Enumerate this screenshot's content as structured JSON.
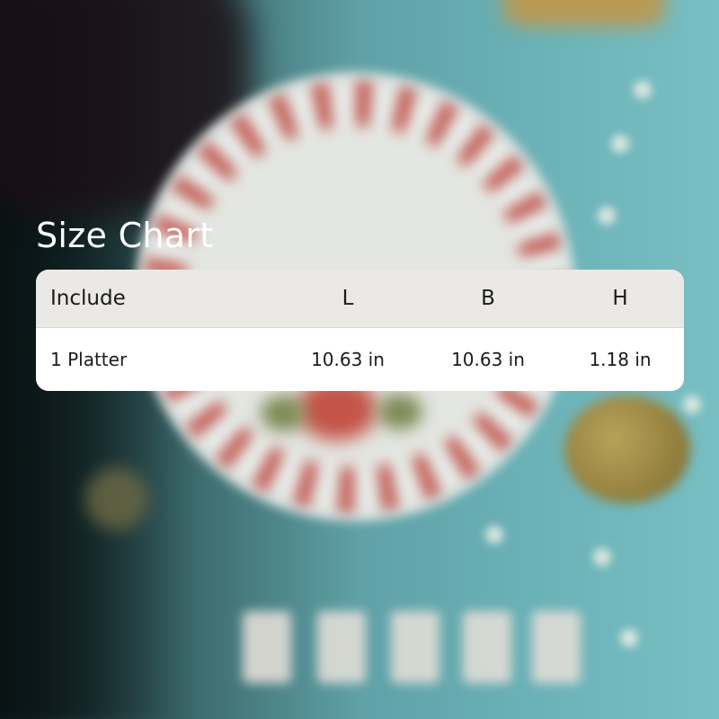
{
  "title": "Size Chart",
  "table": {
    "headers": [
      "Include",
      "L",
      "B",
      "H"
    ],
    "rows": [
      [
        "1 Platter",
        "10.63 in",
        "10.63 in",
        "1.18 in"
      ]
    ]
  },
  "colors": {
    "header_background": "#ebe9e5",
    "row_background": "#ffffff",
    "title_text": "#ffffff",
    "table_text": "#1b1b1b"
  }
}
